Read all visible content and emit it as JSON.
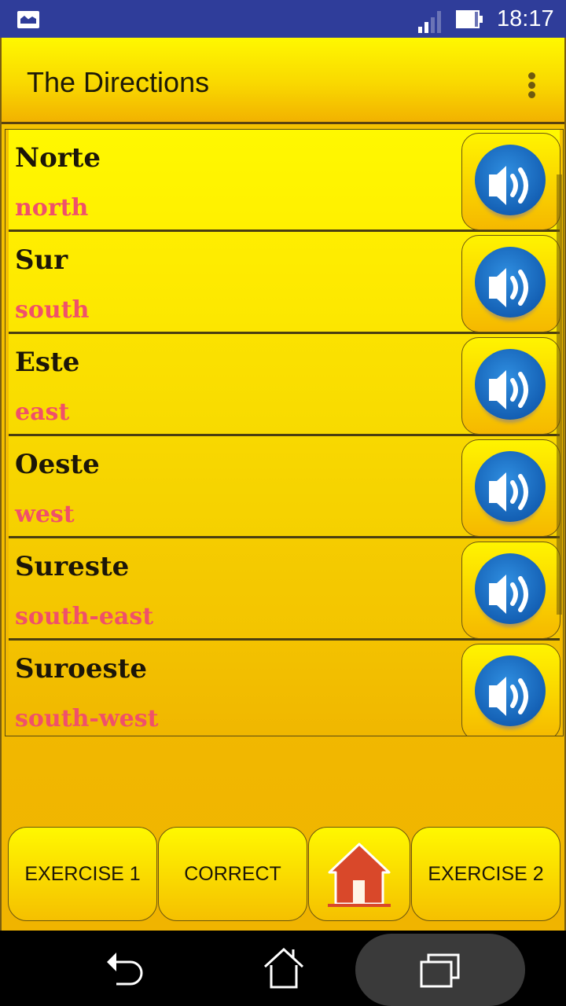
{
  "status_bar": {
    "time": "18:17",
    "icons": [
      "gallery-notification-icon",
      "signal-icon",
      "battery-icon"
    ]
  },
  "action_bar": {
    "title": "The Directions",
    "menu_icon": "overflow-menu-icon"
  },
  "words": [
    {
      "spanish": "Norte",
      "english": "north"
    },
    {
      "spanish": "Sur",
      "english": "south"
    },
    {
      "spanish": "Este",
      "english": "east"
    },
    {
      "spanish": "Oeste",
      "english": "west"
    },
    {
      "spanish": "Sureste",
      "english": "south-east"
    },
    {
      "spanish": "Suroeste",
      "english": "south-west"
    }
  ],
  "bottom_buttons": {
    "exercise1": "EXERCISE 1",
    "correct": "CORRECT",
    "home_icon": "house-icon",
    "exercise2": "EXERCISE 2"
  },
  "nav_bar": {
    "icons": [
      "back-icon",
      "home-icon",
      "recents-icon"
    ]
  },
  "colors": {
    "status_bar": "#2f3d9a",
    "accent_yellow": "#f5c400",
    "english_text": "#f0506a",
    "speaker_blue": "#1460b4"
  }
}
